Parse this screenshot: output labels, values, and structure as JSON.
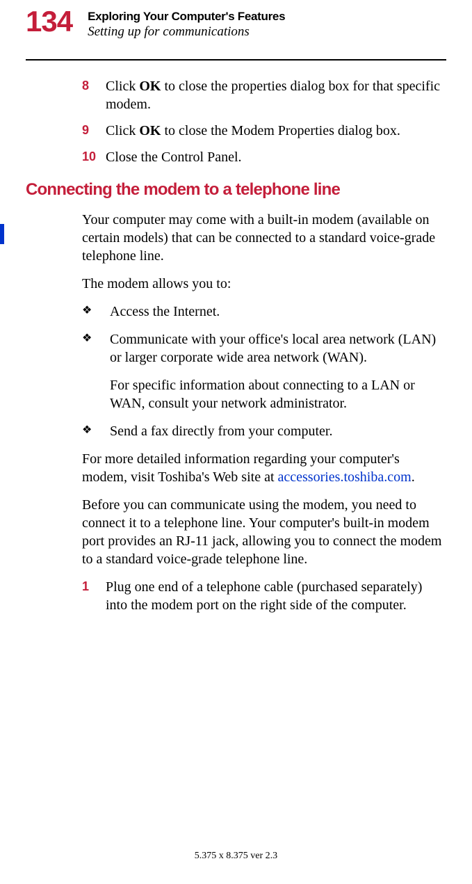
{
  "header": {
    "pageNumber": "134",
    "chapterTitle": "Exploring Your Computer's Features",
    "sectionTitle": "Setting up for communications"
  },
  "steps_a": [
    {
      "num": "8",
      "pre": "Click ",
      "bold": "OK",
      "post": " to close the properties dialog box for that specific modem."
    },
    {
      "num": "9",
      "pre": "Click ",
      "bold": "OK",
      "post": " to close the Modem Properties dialog box."
    },
    {
      "num": "10",
      "pre": "Close the Control Panel.",
      "bold": "",
      "post": ""
    }
  ],
  "sectionHeading": "Connecting the modem to a telephone line",
  "para1": "Your computer may come with a built-in modem (available on certain models) that can be connected to a standard voice-grade telephone line.",
  "para2": "The modem allows you to:",
  "bullets": [
    {
      "text": "Access the Internet.",
      "sub": ""
    },
    {
      "text": "Communicate with your office's local area network (LAN) or larger corporate wide area network (WAN).",
      "sub": "For specific information about connecting to a LAN or WAN, consult your network administrator."
    },
    {
      "text": "Send a fax directly from your computer.",
      "sub": ""
    }
  ],
  "para3_pre": "For more detailed information regarding your computer's modem, visit Toshiba's Web site at ",
  "para3_link": "accessories.toshiba.com",
  "para3_post": ".",
  "para4": "Before you can communicate using the modem, you need to connect it to a telephone line. Your computer's built-in modem port provides an RJ-11 jack, allowing you to connect the modem to a standard voice-grade telephone line.",
  "steps_b": [
    {
      "num": "1",
      "text": "Plug one end of a telephone cable (purchased separately) into the modem port on the right side of the computer."
    }
  ],
  "footer": "5.375 x 8.375 ver 2.3",
  "bulletGlyph": "❖"
}
